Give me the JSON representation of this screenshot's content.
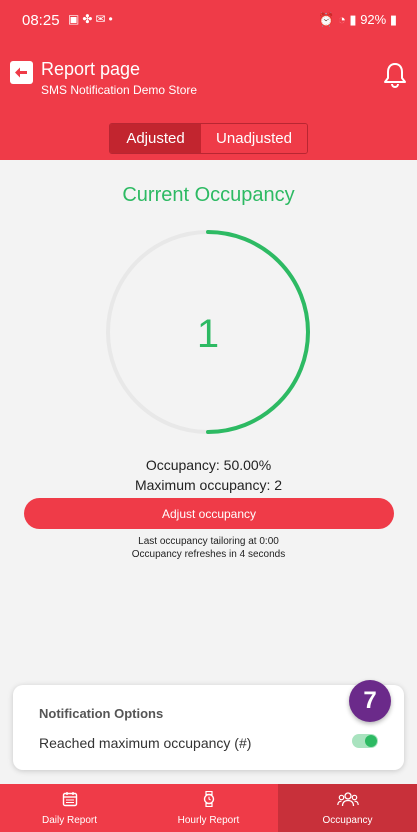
{
  "status_bar": {
    "time": "08:25",
    "battery": "92%"
  },
  "header": {
    "title": "Report page",
    "subtitle": "SMS Notification Demo Store"
  },
  "segment": {
    "adjusted": "Adjusted",
    "unadjusted": "Unadjusted"
  },
  "occupancy": {
    "title": "Current Occupancy",
    "current": "1",
    "fraction": 0.5,
    "percent_text": "Occupancy: 50.00%",
    "max_text": "Maximum occupancy: 2",
    "adjust_label": "Adjust occupancy",
    "tailoring_text": "Last occupancy tailoring at 0:00",
    "refresh_text": "Occupancy refreshes in 4 seconds"
  },
  "notifications": {
    "title": "Notification Options",
    "reached_max_label": "Reached maximum occupancy (#)",
    "reached_max_enabled": true
  },
  "badge": {
    "count": "7"
  },
  "nav": {
    "daily": "Daily Report",
    "hourly": "Hourly Report",
    "occupancy": "Occupancy"
  },
  "colors": {
    "primary": "#ef3b48",
    "accent_green": "#2dba63",
    "badge": "#6b2a8a"
  }
}
